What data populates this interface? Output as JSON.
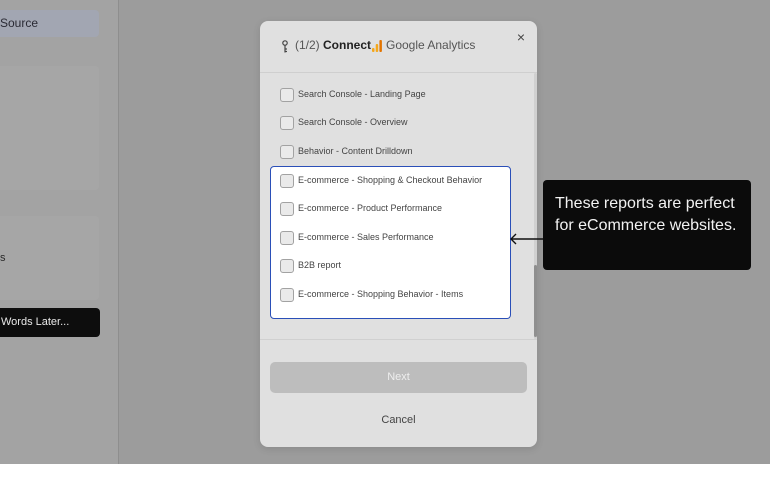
{
  "sidebar": {
    "source_label": "Source",
    "partial_label": "s",
    "words_later_label": "Words Later..."
  },
  "modal": {
    "step": "(1/2)",
    "connect": "Connect",
    "integration": "Google Analytics",
    "close_icon": "×",
    "items": [
      {
        "label": "Search Console - Landing Page",
        "checked": false
      },
      {
        "label": "Search Console - Overview",
        "checked": false
      },
      {
        "label": "Behavior - Content Drilldown",
        "checked": false
      },
      {
        "label": "E-commerce - Shopping & Checkout Behavior",
        "checked": false
      },
      {
        "label": "E-commerce - Product Performance",
        "checked": false
      },
      {
        "label": "E-commerce - Sales Performance",
        "checked": false
      },
      {
        "label": "B2B report",
        "checked": false
      },
      {
        "label": "E-commerce - Shopping Behavior - Items",
        "checked": false
      }
    ],
    "next_label": "Next",
    "cancel_label": "Cancel"
  },
  "tooltip": {
    "text": "These reports are perfect for eCommerce websites."
  },
  "colors": {
    "highlight_border": "#2a4fb8",
    "tooltip_bg": "#0b0b0b",
    "overlay_bg": "#9c9c9c",
    "ga_orange": "#f4a71c"
  }
}
